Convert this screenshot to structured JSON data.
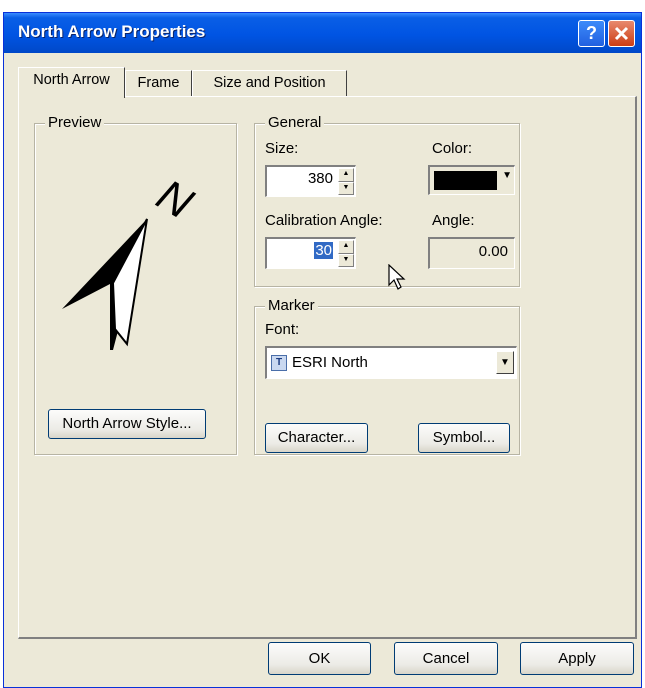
{
  "window": {
    "title": "North Arrow Properties",
    "help": "?"
  },
  "tabs": [
    "North Arrow",
    "Frame",
    "Size and Position"
  ],
  "preview": {
    "label": "Preview",
    "glyph": "N",
    "style_button": "North Arrow Style..."
  },
  "general": {
    "label": "General",
    "size_label": "Size:",
    "size_value": "380",
    "color_label": "Color:",
    "color_value": "#000000",
    "calibration_label": "Calibration Angle:",
    "calibration_value": "30",
    "angle_label": "Angle:",
    "angle_value": "0.00"
  },
  "marker": {
    "label": "Marker",
    "font_label": "Font:",
    "font_value": "ESRI North",
    "font_icon": "T",
    "character_button": "Character...",
    "symbol_button": "Symbol..."
  },
  "footer": {
    "ok": "OK",
    "cancel": "Cancel",
    "apply": "Apply"
  }
}
